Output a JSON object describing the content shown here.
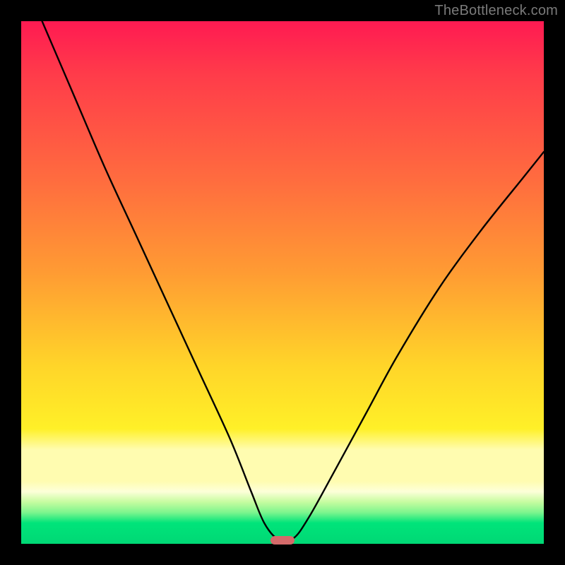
{
  "watermark": "TheBottleneck.com",
  "chart_data": {
    "type": "line",
    "title": "",
    "xlabel": "",
    "ylabel": "",
    "xlim": [
      0,
      1
    ],
    "ylim": [
      0,
      1
    ],
    "gradient_stops": [
      {
        "pos": 0.0,
        "color": "#ff1a52"
      },
      {
        "pos": 0.1,
        "color": "#ff3b4a"
      },
      {
        "pos": 0.3,
        "color": "#ff6b3f"
      },
      {
        "pos": 0.48,
        "color": "#ff9b33"
      },
      {
        "pos": 0.66,
        "color": "#ffd529"
      },
      {
        "pos": 0.78,
        "color": "#fff028"
      },
      {
        "pos": 0.82,
        "color": "#fffcb0"
      },
      {
        "pos": 0.88,
        "color": "#fffcb0"
      },
      {
        "pos": 0.9,
        "color": "#fdffd9"
      },
      {
        "pos": 0.92,
        "color": "#c6fca0"
      },
      {
        "pos": 0.94,
        "color": "#7df58e"
      },
      {
        "pos": 0.96,
        "color": "#00e47a"
      },
      {
        "pos": 1.0,
        "color": "#00d875"
      }
    ],
    "series": [
      {
        "name": "curve",
        "x": [
          0.04,
          0.1,
          0.16,
          0.22,
          0.28,
          0.34,
          0.4,
          0.44,
          0.465,
          0.49,
          0.52,
          0.55,
          0.6,
          0.66,
          0.72,
          0.8,
          0.88,
          0.96,
          1.0
        ],
        "y": [
          1.0,
          0.86,
          0.72,
          0.59,
          0.46,
          0.33,
          0.2,
          0.1,
          0.04,
          0.01,
          0.01,
          0.05,
          0.14,
          0.25,
          0.36,
          0.49,
          0.6,
          0.7,
          0.75
        ]
      }
    ],
    "trough": {
      "x": 0.5,
      "y": 0.01
    },
    "marker": {
      "x": 0.5,
      "y": 0.007,
      "color": "#d46a6a"
    }
  }
}
